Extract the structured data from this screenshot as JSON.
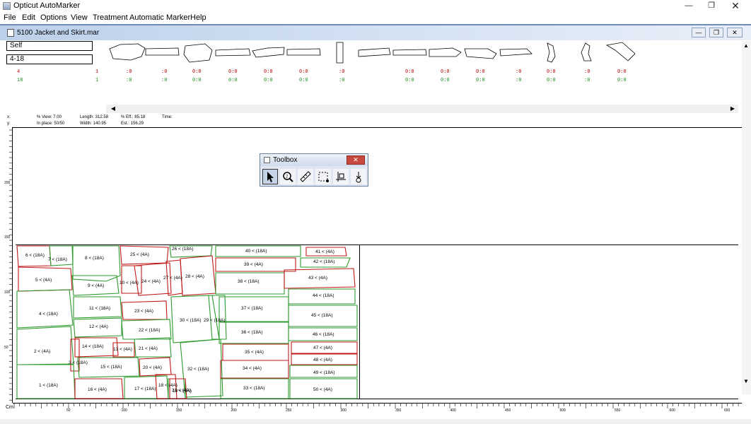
{
  "window": {
    "title": "Opticut AutoMarker",
    "buttons": [
      "minimize",
      "maximize",
      "close"
    ]
  },
  "menu": [
    "File",
    "Edit",
    "Options",
    "View",
    "Treatment",
    "Automatic Marker",
    "Help"
  ],
  "document": {
    "title": "5100 Jacket and Skirt.mar",
    "fabric": "Self",
    "size_range": "4-18"
  },
  "piece_counts": {
    "row1_sizes": "4",
    "row2_sizes": "18",
    "row1": [
      "1",
      ":0",
      ":0",
      "0:0",
      "0:0",
      "0:0",
      "0:0",
      ":0",
      "0:0",
      "0:0",
      "0:0",
      "0:0",
      ":0",
      "0:0",
      ":0",
      "0:0"
    ],
    "row2": [
      "1",
      ":0",
      ":0",
      "0:0",
      "0:0",
      "0:0",
      "0:0",
      ":0",
      "0:0",
      "0:0",
      "0:0",
      "0:0",
      ":0",
      "0:0",
      ":0",
      "0:0"
    ]
  },
  "status": {
    "x_label": "x:",
    "y_label": "y:",
    "view": "% View:  7.00",
    "in_place": "In place:  50/50",
    "length": "Length:  312.58",
    "width": "Width:  140.95",
    "efficiency": "% Eff.:  85.18",
    "estimate": "Est.:     156.29",
    "time": "Time:"
  },
  "ruler": {
    "unit": "Cm",
    "labels": [
      "50",
      "100",
      "150",
      "200",
      "250",
      "300",
      "350",
      "400",
      "450",
      "500",
      "550",
      "600",
      "650"
    ]
  },
  "vruler": [
    "200",
    "150",
    "100",
    "50"
  ],
  "toolbox": {
    "title": "Toolbox",
    "tools": [
      "select-arrow-icon",
      "zoom-icon",
      "measure-ruler-icon",
      "rubber-band-icon",
      "grid-align-icon",
      "pin-drop-icon"
    ]
  },
  "pieces": [
    {
      "id": "p6",
      "label": "6 < (18A)"
    },
    {
      "id": "p7",
      "label": "7 < (18A)"
    },
    {
      "id": "p8",
      "label": "8 < (18A)"
    },
    {
      "id": "p5",
      "label": "5 < (4A)"
    },
    {
      "id": "p9",
      "label": "9 < (4A)"
    },
    {
      "id": "p4",
      "label": "4 < (18A)"
    },
    {
      "id": "p2",
      "label": "2 < (4A)"
    },
    {
      "id": "p3",
      "label": "3 < (18A)"
    },
    {
      "id": "p1",
      "label": "1 < (18A)"
    },
    {
      "id": "p11",
      "label": "11 < (18A)"
    },
    {
      "id": "p12",
      "label": "12 < (4A)"
    },
    {
      "id": "p14",
      "label": "14 < (18A)"
    },
    {
      "id": "p15",
      "label": "15 < (18A)"
    },
    {
      "id": "p16",
      "label": "16 < (4A)"
    },
    {
      "id": "p25",
      "label": "25 < (4A)"
    },
    {
      "id": "p10",
      "label": "10 < (4A)"
    },
    {
      "id": "p24",
      "label": "24 < (4A)"
    },
    {
      "id": "p23",
      "label": "23 < (4A)"
    },
    {
      "id": "p22",
      "label": "22 < (18A)"
    },
    {
      "id": "p13",
      "label": "13 < (4A)"
    },
    {
      "id": "p21",
      "label": "21 < (4A)"
    },
    {
      "id": "p20",
      "label": "20 < (4A)"
    },
    {
      "id": "p17",
      "label": "17 < (18A)"
    },
    {
      "id": "p18",
      "label": "18 < (4A)"
    },
    {
      "id": "p19",
      "label": "19 < (4A)"
    },
    {
      "id": "p26",
      "label": "26 < (18A)"
    },
    {
      "id": "p27",
      "label": "27 < (4A)"
    },
    {
      "id": "p28",
      "label": "28 < (4A)"
    },
    {
      "id": "p30",
      "label": "30 < (18A)"
    },
    {
      "id": "p29",
      "label": "29 < (18A)"
    },
    {
      "id": "p32",
      "label": "32 < (18A)"
    },
    {
      "id": "p31",
      "label": "31 < (4A)"
    },
    {
      "id": "p40",
      "label": "40 < (18A)"
    },
    {
      "id": "p39",
      "label": "39 < (4A)"
    },
    {
      "id": "p38",
      "label": "38 < (18A)"
    },
    {
      "id": "p37",
      "label": "37 < (18A)"
    },
    {
      "id": "p36",
      "label": "36 < (18A)"
    },
    {
      "id": "p35",
      "label": "35 < (4A)"
    },
    {
      "id": "p34",
      "label": "34 < (4A)"
    },
    {
      "id": "p33",
      "label": "33 < (18A)"
    },
    {
      "id": "p41",
      "label": "41 < (4A)"
    },
    {
      "id": "p42",
      "label": "42 < (18A)"
    },
    {
      "id": "p43",
      "label": "43 < (4A)"
    },
    {
      "id": "p44",
      "label": "44 < (18A)"
    },
    {
      "id": "p45",
      "label": "45 < (18A)"
    },
    {
      "id": "p46",
      "label": "46 < (18A)"
    },
    {
      "id": "p47",
      "label": "47 < (4A)"
    },
    {
      "id": "p48",
      "label": "48 < (4A)"
    },
    {
      "id": "p49",
      "label": "49 < (18A)"
    },
    {
      "id": "p50",
      "label": "50 < (4A)"
    }
  ],
  "colors": {
    "size4": "#c00000",
    "size18": "#1a8a1a",
    "mdi_bg": "#6f8db8"
  }
}
